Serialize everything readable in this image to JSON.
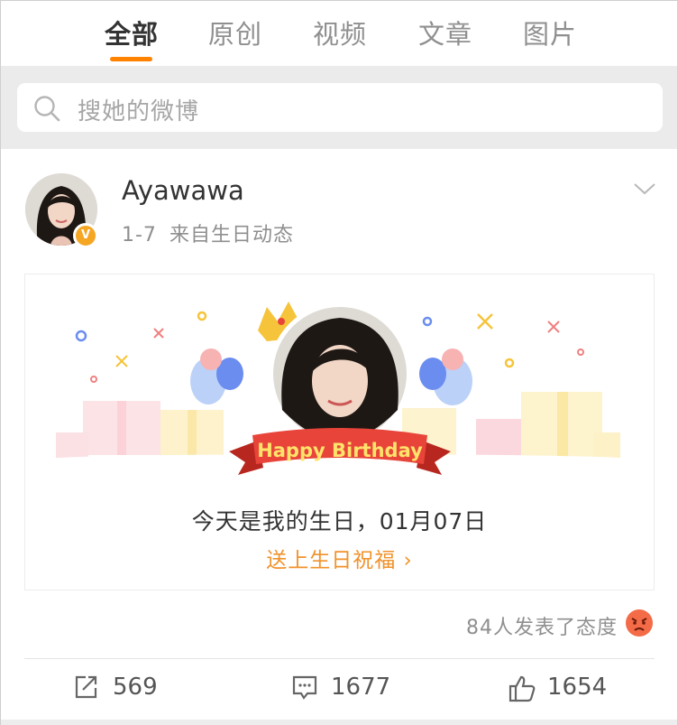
{
  "tabs": [
    {
      "label": "全部",
      "active": true
    },
    {
      "label": "原创",
      "active": false
    },
    {
      "label": "视频",
      "active": false
    },
    {
      "label": "文章",
      "active": false
    },
    {
      "label": "图片",
      "active": false
    }
  ],
  "search": {
    "placeholder": "搜她的微博",
    "icon": "search-icon"
  },
  "post": {
    "username": "Ayawawa",
    "date": "1-7",
    "source": "来自生日动态",
    "verified_badge": "V",
    "card": {
      "banner_text": "Happy Birthday",
      "text": "今天是我的生日，01月07日",
      "link": "送上生日祝福 ›"
    },
    "reactions_summary": "84人发表了态度",
    "reaction_icon": "angry-face-icon",
    "actions": {
      "repost": "569",
      "comment": "1677",
      "like": "1654"
    }
  },
  "colors": {
    "accent": "#ff8200",
    "link": "#f0922b",
    "badge": "#f5a623",
    "banner": "#e8443a"
  }
}
